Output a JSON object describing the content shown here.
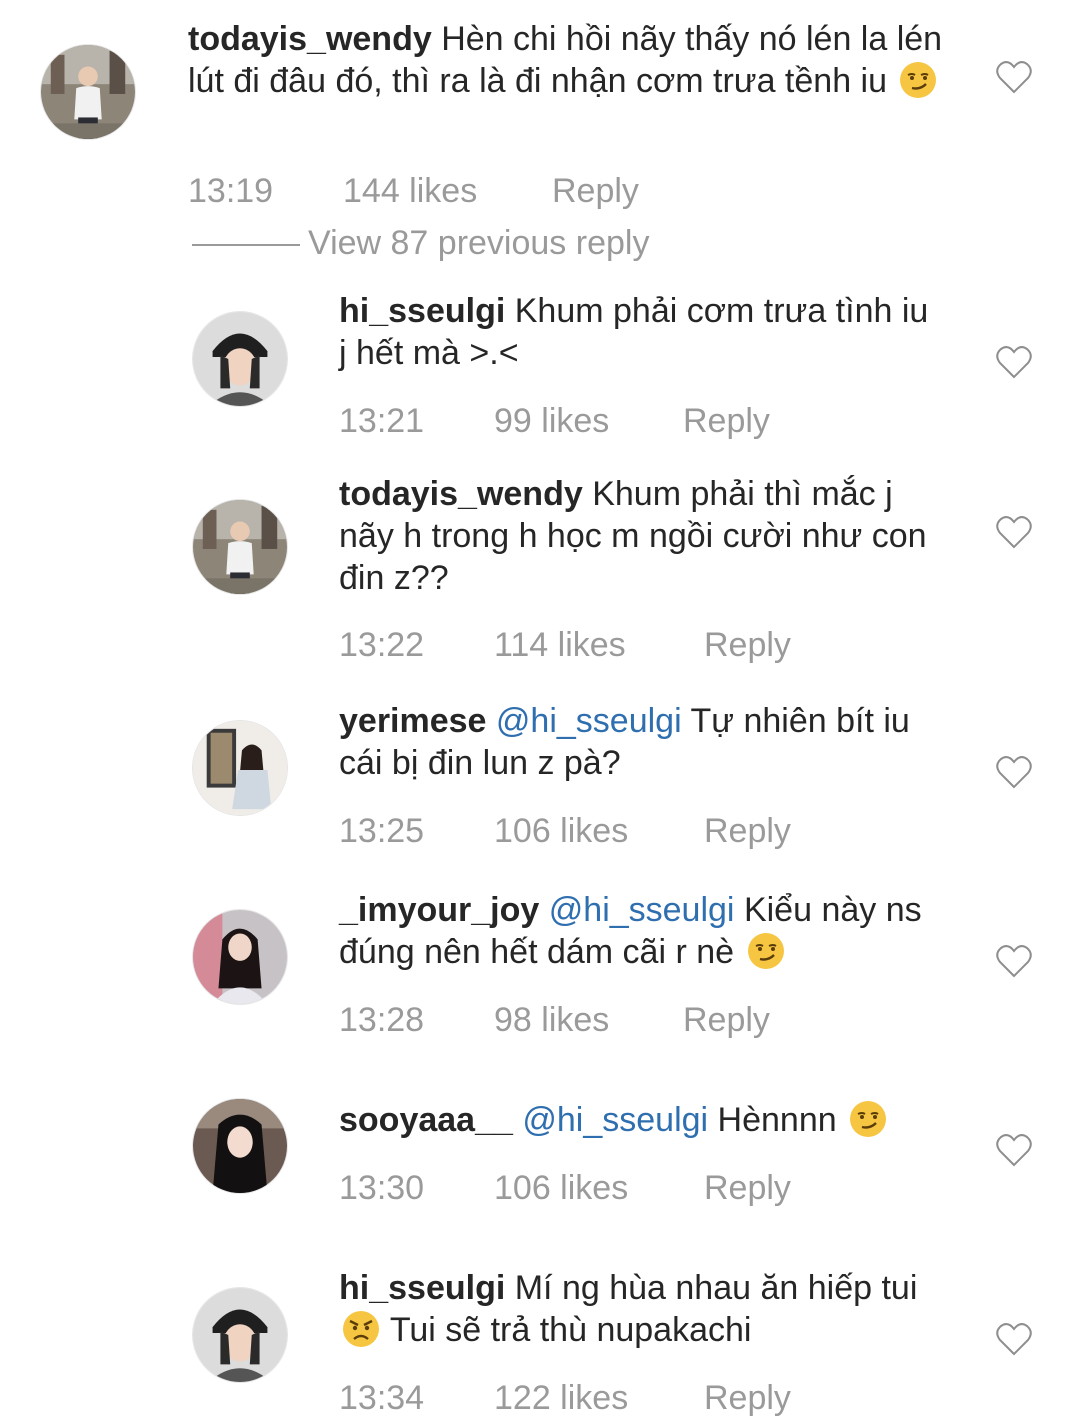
{
  "comments": [
    {
      "username": "todayis_wendy",
      "mention": "",
      "text": "Hèn chi hồi nãy thấy nó lén la lén lút đi đâu đó, thì ra là đi nhận cơm trưa tềnh iu",
      "emoji": "smirk",
      "time": "13:19",
      "likes": "144 likes",
      "reply": "Reply"
    },
    {
      "username": "hi_sseulgi",
      "mention": "",
      "text": "Khum phải cơm trưa tình iu j hết mà >.<",
      "emoji": "",
      "time": "13:21",
      "likes": "99 likes",
      "reply": "Reply"
    },
    {
      "username": "todayis_wendy",
      "mention": "",
      "text": "Khum phải thì mắc j nãy h trong h học m ngồi cười như con đin z??",
      "emoji": "",
      "time": "13:22",
      "likes": "114 likes",
      "reply": "Reply"
    },
    {
      "username": "yerimese",
      "mention": "@hi_sseulgi",
      "text": "Tự nhiên bít iu cái bị đin lun z pà?",
      "emoji": "",
      "time": "13:25",
      "likes": "106 likes",
      "reply": "Reply"
    },
    {
      "username": "_imyour_joy",
      "mention": "@hi_sseulgi",
      "text": "Kiểu này ns đúng nên hết dám cãi r nè",
      "emoji": "smirk",
      "time": "13:28",
      "likes": "98 likes",
      "reply": "Reply"
    },
    {
      "username": "sooyaaa__",
      "mention": "@hi_sseulgi",
      "text": "Hènnnn",
      "emoji": "smirk",
      "time": "13:30",
      "likes": "106 likes",
      "reply": "Reply"
    },
    {
      "username": "hi_sseulgi",
      "mention": "",
      "text": "Mí ng hùa nhau ăn hiếp tui",
      "emoji": "angry",
      "text_after": "Tui sẽ trả thù nupakachi",
      "time": "13:34",
      "likes": "122 likes",
      "reply": "Reply"
    }
  ],
  "view_previous": "View 87 previous reply",
  "colors": {
    "mention": "#2f6fb0",
    "meta": "#9a9a9a",
    "text": "#262626"
  }
}
